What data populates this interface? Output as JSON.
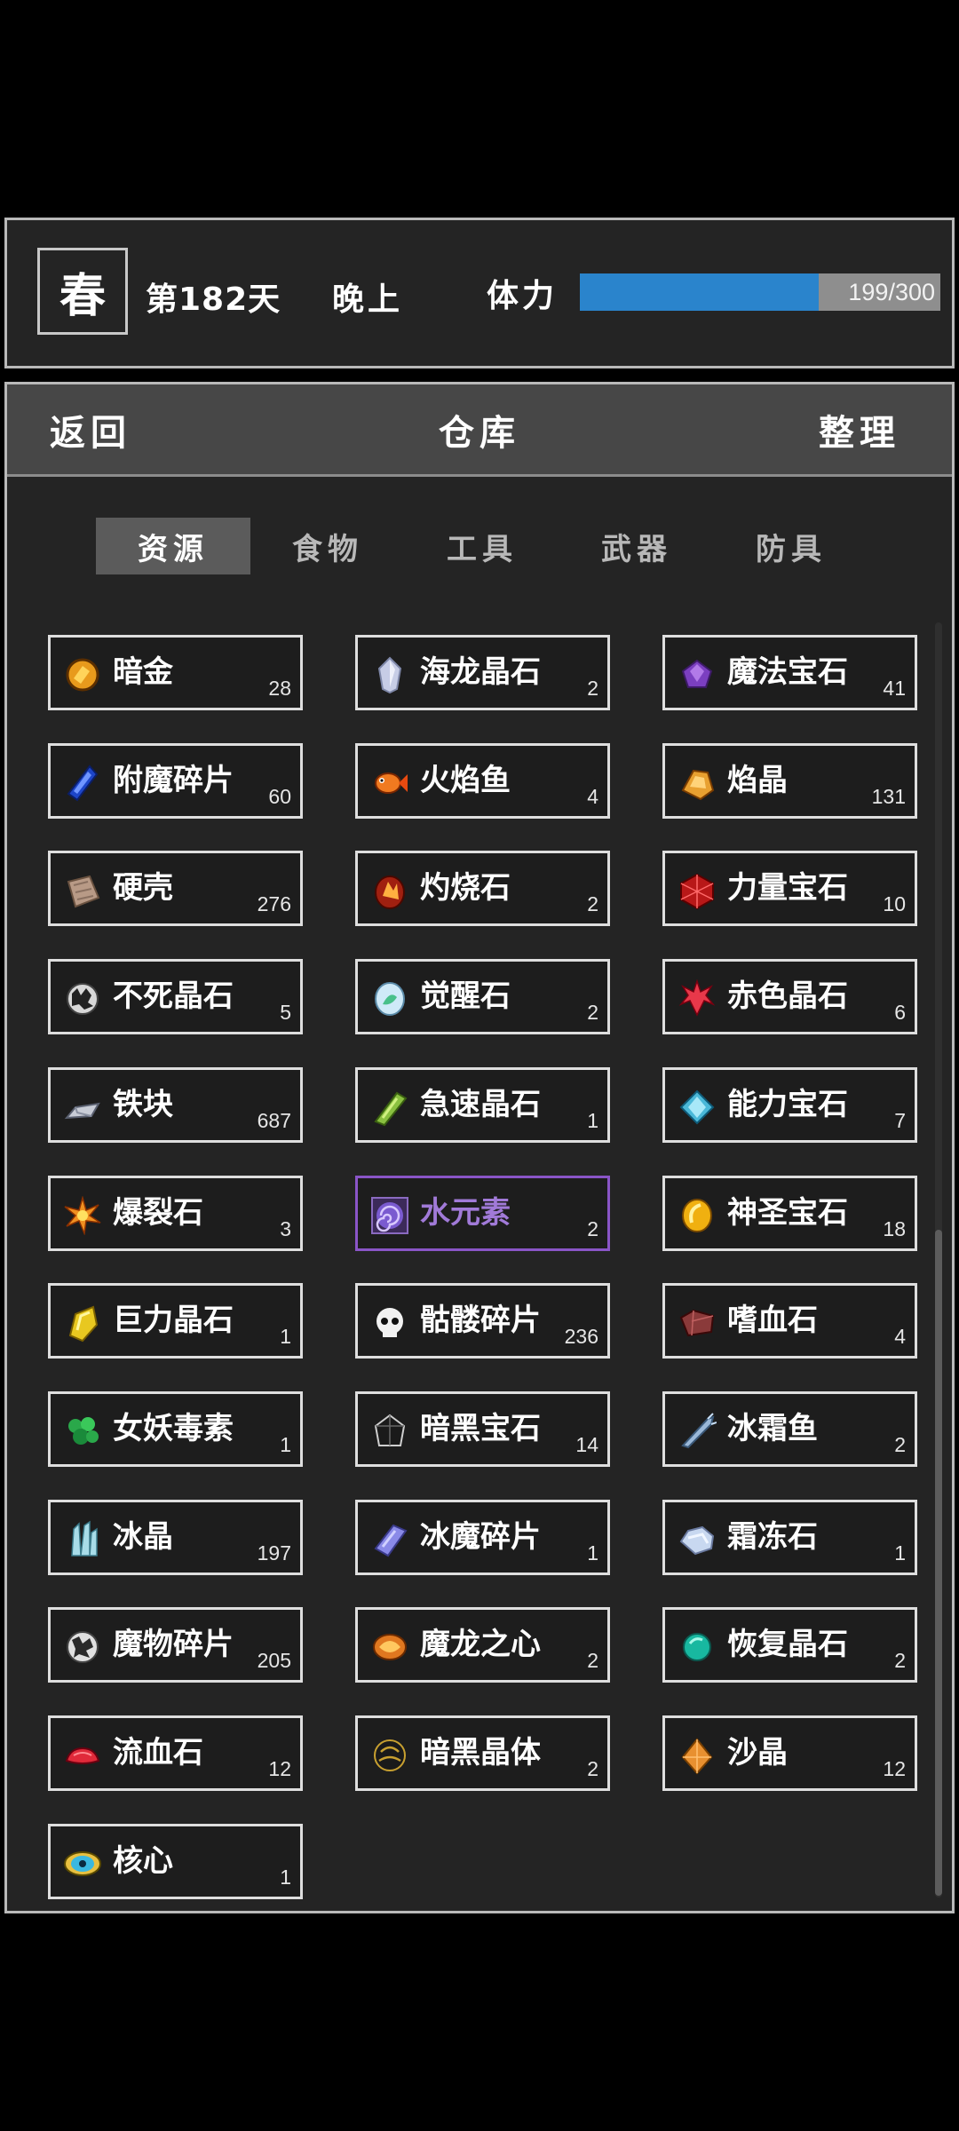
{
  "status": {
    "season": "春",
    "day": "第182天",
    "time_of_day": "晚上",
    "stamina_label": "体力",
    "stamina_text": "199/300",
    "stamina_value": 199,
    "stamina_max": 300,
    "stamina_color": "#2a84cc"
  },
  "storage": {
    "back_label": "返回",
    "title": "仓库",
    "sort_label": "整理",
    "tabs": [
      {
        "label": "资源",
        "active": true
      },
      {
        "label": "食物",
        "active": false
      },
      {
        "label": "工具",
        "active": false
      },
      {
        "label": "武器",
        "active": false
      },
      {
        "label": "防具",
        "active": false
      }
    ],
    "items": [
      {
        "name": "暗金",
        "count": "28",
        "icon": "dark-gold-icon"
      },
      {
        "name": "海龙晶石",
        "count": "2",
        "icon": "sea-dragon-crystal-icon"
      },
      {
        "name": "魔法宝石",
        "count": "41",
        "icon": "magic-gem-icon"
      },
      {
        "name": "附魔碎片",
        "count": "60",
        "icon": "enchant-shard-icon"
      },
      {
        "name": "火焰鱼",
        "count": "4",
        "icon": "fire-fish-icon"
      },
      {
        "name": "焰晶",
        "count": "131",
        "icon": "flame-crystal-icon"
      },
      {
        "name": "硬壳",
        "count": "276",
        "icon": "hard-shell-icon"
      },
      {
        "name": "灼烧石",
        "count": "2",
        "icon": "scorch-stone-icon"
      },
      {
        "name": "力量宝石",
        "count": "10",
        "icon": "power-gem-icon"
      },
      {
        "name": "不死晶石",
        "count": "5",
        "icon": "undead-crystal-icon"
      },
      {
        "name": "觉醒石",
        "count": "2",
        "icon": "awakening-stone-icon"
      },
      {
        "name": "赤色晶石",
        "count": "6",
        "icon": "red-crystal-icon"
      },
      {
        "name": "铁块",
        "count": "687",
        "icon": "iron-ingot-icon"
      },
      {
        "name": "急速晶石",
        "count": "1",
        "icon": "haste-crystal-icon"
      },
      {
        "name": "能力宝石",
        "count": "7",
        "icon": "ability-gem-icon"
      },
      {
        "name": "爆裂石",
        "count": "3",
        "icon": "burst-stone-icon"
      },
      {
        "name": "水元素",
        "count": "2",
        "icon": "water-element-icon",
        "selected": true
      },
      {
        "name": "神圣宝石",
        "count": "18",
        "icon": "holy-gem-icon"
      },
      {
        "name": "巨力晶石",
        "count": "1",
        "icon": "giant-crystal-icon"
      },
      {
        "name": "骷髅碎片",
        "count": "236",
        "icon": "skull-shard-icon"
      },
      {
        "name": "嗜血石",
        "count": "4",
        "icon": "bloodthirst-stone-icon"
      },
      {
        "name": "女妖毒素",
        "count": "1",
        "icon": "banshee-toxin-icon"
      },
      {
        "name": "暗黑宝石",
        "count": "14",
        "icon": "dark-gem-icon"
      },
      {
        "name": "冰霜鱼",
        "count": "2",
        "icon": "frost-fish-icon"
      },
      {
        "name": "冰晶",
        "count": "197",
        "icon": "ice-crystal-icon"
      },
      {
        "name": "冰魔碎片",
        "count": "1",
        "icon": "ice-demon-shard-icon"
      },
      {
        "name": "霜冻石",
        "count": "1",
        "icon": "frost-stone-icon"
      },
      {
        "name": "魔物碎片",
        "count": "205",
        "icon": "monster-shard-icon"
      },
      {
        "name": "魔龙之心",
        "count": "2",
        "icon": "dragon-heart-icon"
      },
      {
        "name": "恢复晶石",
        "count": "2",
        "icon": "recovery-crystal-icon"
      },
      {
        "name": "流血石",
        "count": "12",
        "icon": "bleed-stone-icon"
      },
      {
        "name": "暗黑晶体",
        "count": "2",
        "icon": "dark-crystal-icon"
      },
      {
        "name": "沙晶",
        "count": "12",
        "icon": "sand-crystal-icon"
      },
      {
        "name": "核心",
        "count": "1",
        "icon": "core-icon"
      }
    ],
    "colors": {
      "panel_border": "#b9b9b9",
      "panel_bg": "#242424",
      "header_bg": "#474747",
      "active_tab_bg": "#5b5b5b",
      "item_border": "#dedede",
      "selected_border": "#8a55c7"
    }
  }
}
